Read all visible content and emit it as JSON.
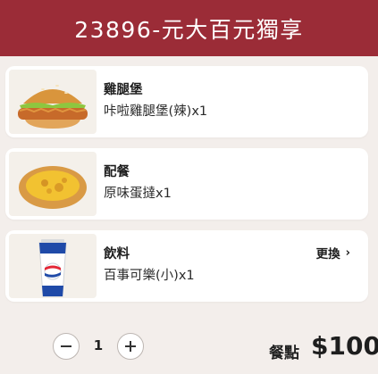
{
  "header": {
    "title": "23896-元大百元獨享"
  },
  "items": [
    {
      "category": "雞腿堡",
      "name": "咔啦雞腿堡(辣)x1",
      "image": "chicken-burger"
    },
    {
      "category": "配餐",
      "name": "原味蛋撻x1",
      "image": "egg-tart"
    },
    {
      "category": "飲料",
      "name": "百事可樂(小)x1",
      "image": "pepsi-cup",
      "change_label": "更換"
    }
  ],
  "quantity": {
    "value": "1",
    "minus_icon": "minus-icon",
    "plus_icon": "plus-icon"
  },
  "footer": {
    "price_label": "餐點",
    "price": "$100"
  },
  "colors": {
    "header_bg": "#9b2c37",
    "page_bg": "#f3eeeb",
    "card_bg": "#ffffff"
  }
}
